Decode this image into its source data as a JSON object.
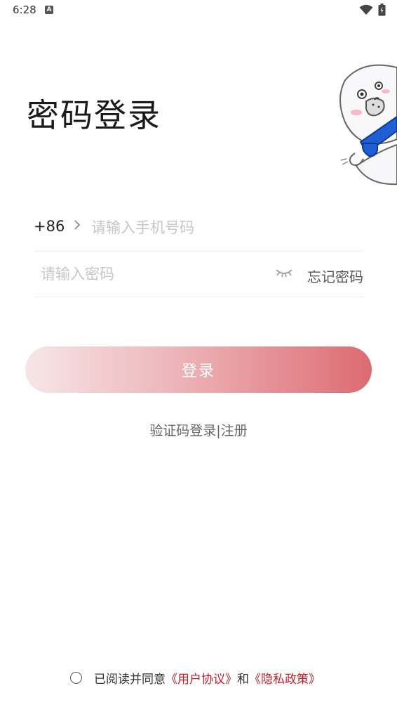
{
  "status_bar": {
    "time": "6:28",
    "notification_badge": "A"
  },
  "login": {
    "title": "密码登录",
    "country_code": "+86",
    "phone_placeholder": "请输入手机号码",
    "password_placeholder": "请输入密码",
    "forgot_password": "忘记密码",
    "login_button": "登录",
    "alt_links": {
      "sms_login": "验证码登录",
      "separator": "|",
      "register": "注册"
    }
  },
  "agreement": {
    "prefix": "已阅读并同意",
    "user_agreement": "《用户协议》",
    "conjunction": "和",
    "privacy_policy": "《隐私政策》"
  },
  "colors": {
    "accent_red": "#c0202a",
    "button_gradient_end": "#dd6b72",
    "mascot_scarf": "#1f5fd6"
  }
}
